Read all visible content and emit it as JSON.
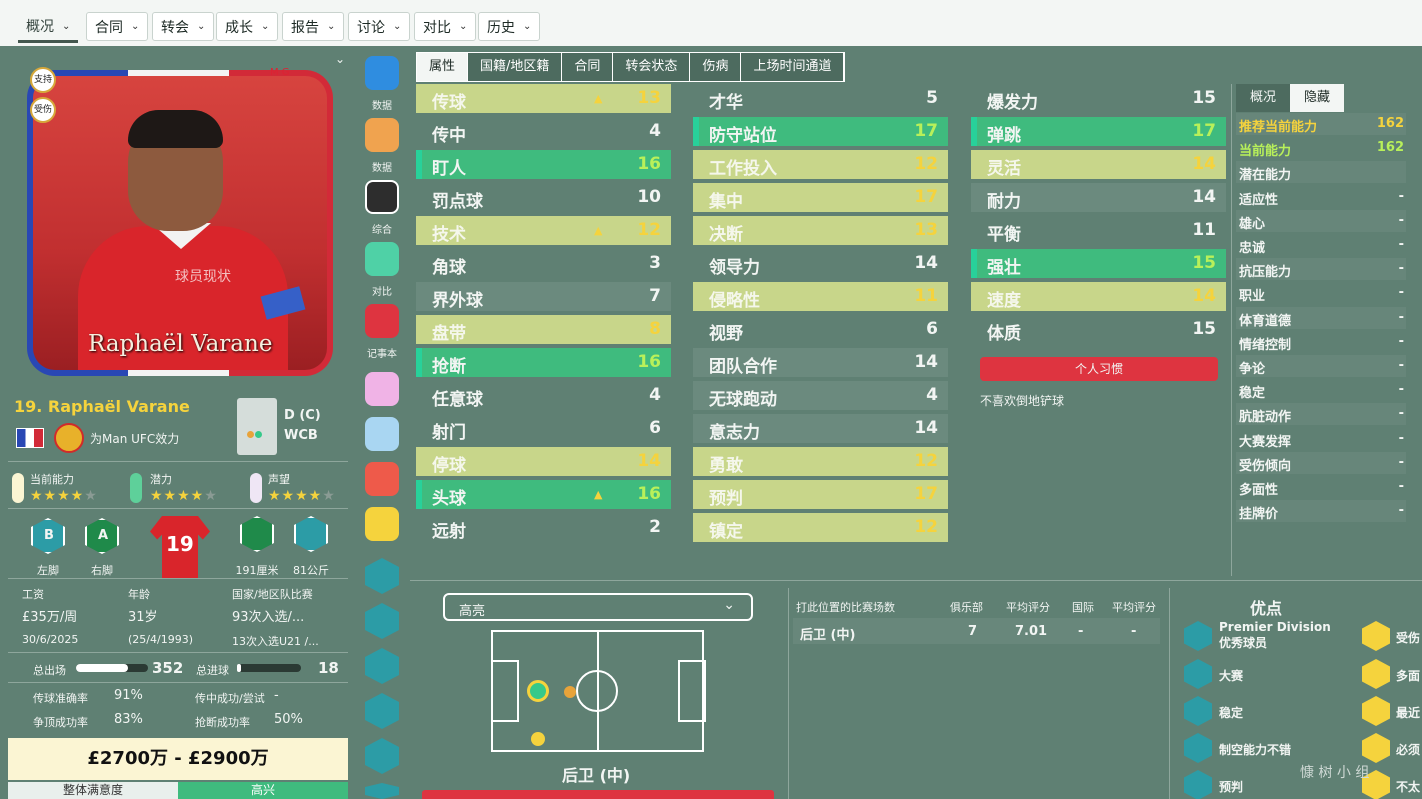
{
  "nav": [
    "概况",
    "合同",
    "转会",
    "成长",
    "报告",
    "讨论",
    "对比",
    "历史"
  ],
  "card": {
    "tags": [
      "支持",
      "受伤"
    ],
    "mg": "M G",
    "watermark": "球员现状",
    "name": "Raphaël Varane"
  },
  "player": {
    "title": "19. Raphaël Varane",
    "club_text": "为Man UFC效力",
    "position": "D (C)",
    "role": "WCB",
    "ratings": [
      {
        "label": "当前能力",
        "stars": 4,
        "color": "#fbf5d3"
      },
      {
        "label": "潜力",
        "stars": 4,
        "color": "#5ed09a"
      },
      {
        "label": "声望",
        "stars": 4,
        "color": "#efe6f5"
      }
    ],
    "foot_left": "B",
    "foot_left_label": "左脚",
    "foot_right": "A",
    "foot_right_label": "右脚",
    "shirt_number": "19",
    "height_label": "191厘米",
    "weight_label": "81公斤",
    "wage_label": "工资",
    "wage": "£35万/周",
    "contract_end": "30/6/2025",
    "age_label": "年龄",
    "age": "31岁",
    "dob": "(25/4/1993)",
    "intl_label": "国家/地区队比赛",
    "intl_caps": "93次入选/...",
    "u21_caps": "13次入选U21 /...",
    "apps_label": "总出场",
    "apps": "352",
    "apps_fill": 0.72,
    "goals_label": "总进球",
    "goals": "18",
    "goals_fill": 0.06,
    "pass_label": "传球准确率",
    "pass": "91%",
    "cross_label": "传中成功/尝试",
    "cross": "-",
    "header_label": "争顶成功率",
    "header": "83%",
    "tackle_label": "抢断成功率",
    "tackle": "50%",
    "value": "£2700万 - £2900万",
    "morale_label": "整体满意度",
    "morale": "高兴"
  },
  "sidebar": [
    "数据",
    "数据",
    "综合",
    "对比",
    "记事本"
  ],
  "tabs": [
    "属性",
    "国籍/地区籍",
    "合同",
    "转会状态",
    "伤病",
    "上场时间通道"
  ],
  "tech": [
    {
      "n": "传球",
      "v": "13",
      "s": "lime",
      "arrow": true
    },
    {
      "n": "传中",
      "v": "4",
      "s": "plain"
    },
    {
      "n": "盯人",
      "v": "16",
      "s": "green"
    },
    {
      "n": "罚点球",
      "v": "10",
      "s": "plain"
    },
    {
      "n": "技术",
      "v": "12",
      "s": "lime",
      "arrow": true
    },
    {
      "n": "角球",
      "v": "3",
      "s": "plain"
    },
    {
      "n": "界外球",
      "v": "7",
      "s": "faint"
    },
    {
      "n": "盘带",
      "v": "8",
      "s": "lime"
    },
    {
      "n": "抢断",
      "v": "16",
      "s": "green"
    },
    {
      "n": "任意球",
      "v": "4",
      "s": "plain"
    },
    {
      "n": "射门",
      "v": "6",
      "s": "plain"
    },
    {
      "n": "停球",
      "v": "14",
      "s": "lime"
    },
    {
      "n": "头球",
      "v": "16",
      "s": "green",
      "arrow": true
    },
    {
      "n": "远射",
      "v": "2",
      "s": "plain"
    }
  ],
  "mental": [
    {
      "n": "才华",
      "v": "5",
      "s": "plain"
    },
    {
      "n": "防守站位",
      "v": "17",
      "s": "green"
    },
    {
      "n": "工作投入",
      "v": "12",
      "s": "lime"
    },
    {
      "n": "集中",
      "v": "17",
      "s": "lime"
    },
    {
      "n": "决断",
      "v": "13",
      "s": "lime"
    },
    {
      "n": "领导力",
      "v": "14",
      "s": "plain"
    },
    {
      "n": "侵略性",
      "v": "11",
      "s": "lime"
    },
    {
      "n": "视野",
      "v": "6",
      "s": "plain"
    },
    {
      "n": "团队合作",
      "v": "14",
      "s": "faint"
    },
    {
      "n": "无球跑动",
      "v": "4",
      "s": "faint"
    },
    {
      "n": "意志力",
      "v": "14",
      "s": "faint"
    },
    {
      "n": "勇敢",
      "v": "12",
      "s": "lime"
    },
    {
      "n": "预判",
      "v": "17",
      "s": "lime"
    },
    {
      "n": "镇定",
      "v": "12",
      "s": "lime"
    }
  ],
  "physical": [
    {
      "n": "爆发力",
      "v": "15",
      "s": "plain"
    },
    {
      "n": "弹跳",
      "v": "17",
      "s": "green"
    },
    {
      "n": "灵活",
      "v": "14",
      "s": "lime"
    },
    {
      "n": "耐力",
      "v": "14",
      "s": "faint"
    },
    {
      "n": "平衡",
      "v": "11",
      "s": "plain"
    },
    {
      "n": "强壮",
      "v": "15",
      "s": "green"
    },
    {
      "n": "速度",
      "v": "14",
      "s": "lime"
    },
    {
      "n": "体质",
      "v": "15",
      "s": "plain"
    }
  ],
  "habits_button": "个人习惯",
  "habits_text": "不喜欢倒地铲球",
  "right_tabs": [
    "概况",
    "隐藏"
  ],
  "hidden": [
    {
      "k": "推荐当前能力",
      "v": "162",
      "c": "#f5d33d"
    },
    {
      "k": "当前能力",
      "v": "162",
      "c": "#b8f05a"
    },
    {
      "k": "潜在能力",
      "v": ""
    },
    {
      "k": "适应性",
      "v": "-"
    },
    {
      "k": "雄心",
      "v": "-"
    },
    {
      "k": "忠诚",
      "v": "-"
    },
    {
      "k": "抗压能力",
      "v": "-"
    },
    {
      "k": "职业",
      "v": "-"
    },
    {
      "k": "体育道德",
      "v": "-"
    },
    {
      "k": "情绪控制",
      "v": "-"
    },
    {
      "k": "争论",
      "v": "-"
    },
    {
      "k": "稳定",
      "v": "-"
    },
    {
      "k": "肮脏动作",
      "v": "-"
    },
    {
      "k": "大赛发挥",
      "v": "-"
    },
    {
      "k": "受伤倾向",
      "v": "-"
    },
    {
      "k": "多面性",
      "v": "-"
    },
    {
      "k": "挂牌价",
      "v": "-"
    }
  ],
  "bottom": {
    "dropdown": "高亮",
    "position": "后卫 (中)",
    "table_headers": [
      "打此位置的比赛场数",
      "俱乐部",
      "平均评分",
      "国际",
      "平均评分"
    ],
    "table_row": [
      "后卫 (中)",
      "7",
      "7.01",
      "-",
      "-"
    ],
    "strengths_title": "优点",
    "strengths_left": [
      "Premier Division优秀球员",
      "大赛",
      "稳定",
      "制空能力不错",
      "预判"
    ],
    "strengths_right": [
      "受伤",
      "多面",
      "最近",
      "必须",
      "不太"
    ],
    "watermark": "慷 树 小 组"
  }
}
